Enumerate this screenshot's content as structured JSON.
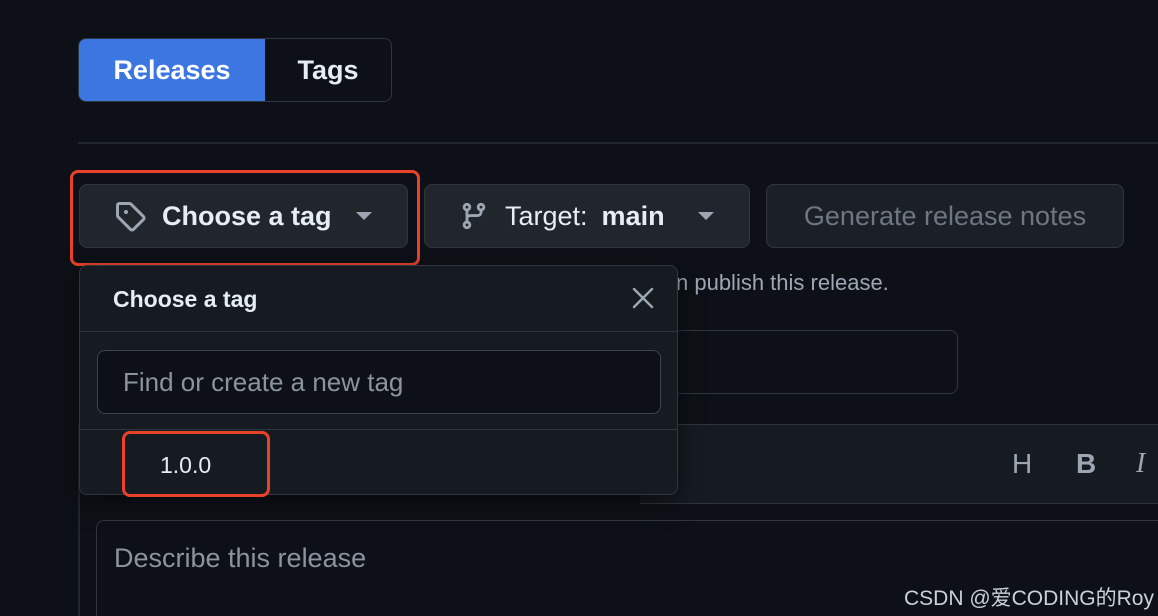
{
  "tabs": {
    "releases_label": "Releases",
    "tags_label": "Tags",
    "active": "Releases"
  },
  "toolbar": {
    "choose_tag_label": "Choose a tag",
    "target_prefix": "Target:",
    "target_value": "main",
    "generate_notes_label": "Generate release notes"
  },
  "helper_text": "n publish this release.",
  "dropdown": {
    "title": "Choose a tag",
    "search_placeholder": "Find or create a new tag",
    "items": [
      {
        "label": "1.0.0"
      }
    ]
  },
  "editor": {
    "toolbar": {
      "heading": "H",
      "bold": "B",
      "italic": "I"
    },
    "placeholder": "Describe this release"
  },
  "watermark": "CSDN @爱CODING的Roy",
  "colors": {
    "accent": "#3b76e1",
    "background": "#0d1117",
    "highlight": "#e8422a"
  },
  "icons": {
    "tag": "tag-icon",
    "branch": "git-branch-icon",
    "caret": "triangle-down-icon",
    "close": "x-icon"
  }
}
